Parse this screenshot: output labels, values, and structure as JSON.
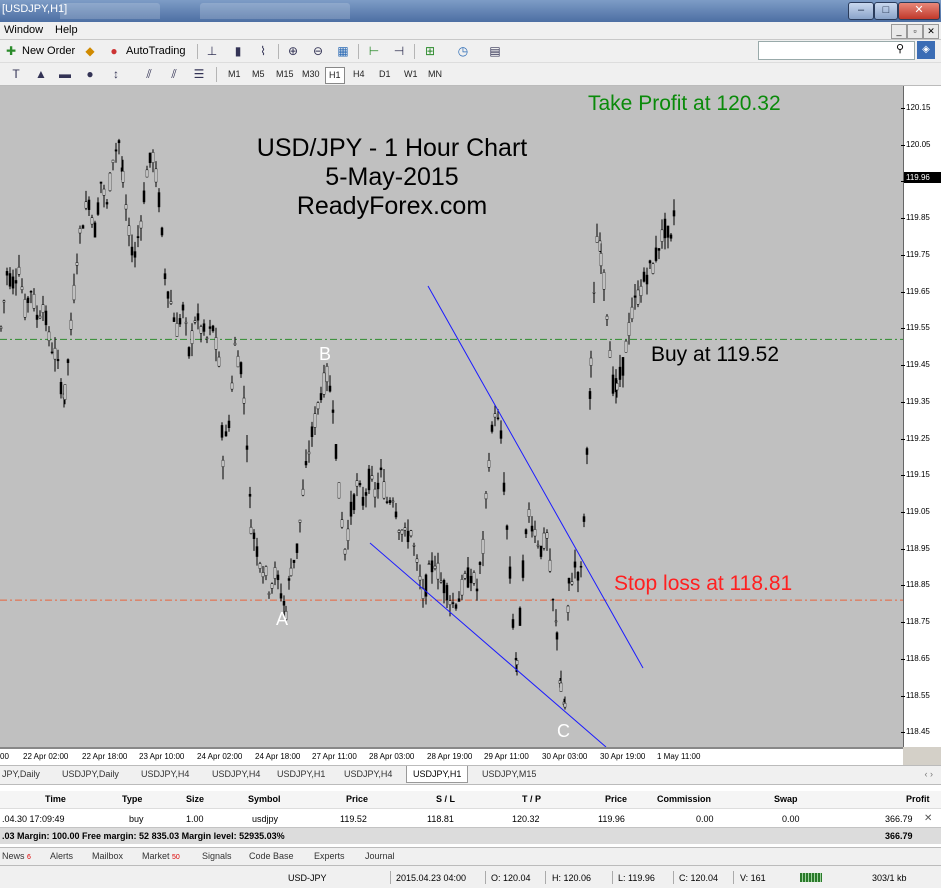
{
  "window": {
    "title": "[USDJPY,H1]",
    "controls": {
      "minimize": "–",
      "maximize": "□",
      "close": "✕"
    }
  },
  "menu": {
    "items": [
      "Window",
      "Help"
    ],
    "mdi_controls": [
      "_",
      "▫",
      "✕"
    ]
  },
  "toolbar1": {
    "new_order": "New Order",
    "autotrading": "AutoTrading",
    "icons": [
      "new-order-icon",
      "experts-icon",
      "autotrading-icon",
      "bar-chart-icon",
      "candlestick-icon",
      "line-chart-icon",
      "zoom-in-icon",
      "zoom-out-icon",
      "tile-windows-icon",
      "auto-scroll-icon",
      "chart-shift-icon",
      "indicators-icon",
      "periods-icon",
      "templates-icon"
    ]
  },
  "toolbar2": {
    "tools": [
      "T",
      "▲",
      "▬",
      "●",
      "↕",
      "⫽",
      "⫽",
      "☰"
    ],
    "timeframes": [
      "M1",
      "M5",
      "M15",
      "M30",
      "H1",
      "H4",
      "D1",
      "W1",
      "MN"
    ],
    "active_timeframe": "H1"
  },
  "search": {
    "placeholder": "",
    "icon": "search-icon"
  },
  "chart": {
    "title_lines": [
      "USD/JPY - 1 Hour Chart",
      "5-May-2015",
      "ReadyForex.com"
    ],
    "annotations": {
      "take_profit": "Take Profit at 120.32",
      "buy": "Buy at 119.52",
      "stop_loss": "Stop loss at 118.81"
    },
    "points": [
      "A",
      "B",
      "C"
    ],
    "current_price": "119.96",
    "price_ticks": [
      "120.15",
      "120.05",
      "119.95",
      "119.85",
      "119.75",
      "119.65",
      "119.55",
      "119.45",
      "119.35",
      "119.25",
      "119.15",
      "119.05",
      "118.95",
      "118.85",
      "118.75",
      "118.65",
      "118.55",
      "118.45"
    ],
    "time_ticks": [
      "00",
      "22 Apr 02:00",
      "22 Apr 18:00",
      "23 Apr 10:00",
      "24 Apr 02:00",
      "24 Apr 18:00",
      "27 Apr 11:00",
      "28 Apr 03:00",
      "28 Apr 19:00",
      "29 Apr 11:00",
      "30 Apr 03:00",
      "30 Apr 19:00",
      "1 May 11:00"
    ],
    "colors": {
      "background": "#c0c0c0",
      "take_profit": "#0a8a0a",
      "stop_loss": "#ff2020",
      "trendline": "#1a1aff",
      "buy_line": "#2e8b2e",
      "sl_line": "#e8643c"
    }
  },
  "chart_data": {
    "type": "candlestick",
    "title": "USD/JPY - 1 Hour Chart",
    "subtitle": "5-May-2015",
    "ylim": [
      118.41,
      120.21
    ],
    "y_ticks": [
      120.15,
      120.05,
      119.95,
      119.85,
      119.75,
      119.65,
      119.55,
      119.45,
      119.35,
      119.25,
      119.15,
      119.05,
      118.95,
      118.85,
      118.75,
      118.65,
      118.55,
      118.45
    ],
    "levels": {
      "take_profit": 120.32,
      "buy": 119.52,
      "stop_loss": 118.81
    },
    "current_price": 119.96,
    "path": [
      [
        0,
        119.55
      ],
      [
        6,
        119.7
      ],
      [
        12,
        119.68
      ],
      [
        18,
        119.72
      ],
      [
        24,
        119.6
      ],
      [
        30,
        119.66
      ],
      [
        36,
        119.58
      ],
      [
        42,
        119.62
      ],
      [
        48,
        119.52
      ],
      [
        54,
        119.48
      ],
      [
        60,
        119.4
      ],
      [
        64,
        119.37
      ],
      [
        70,
        119.55
      ],
      [
        76,
        119.75
      ],
      [
        82,
        119.85
      ],
      [
        88,
        119.9
      ],
      [
        94,
        119.82
      ],
      [
        100,
        119.95
      ],
      [
        106,
        119.88
      ],
      [
        112,
        120.02
      ],
      [
        118,
        120.06
      ],
      [
        122,
        119.95
      ],
      [
        128,
        119.8
      ],
      [
        134,
        119.75
      ],
      [
        140,
        119.85
      ],
      [
        146,
        119.98
      ],
      [
        152,
        120.02
      ],
      [
        158,
        119.9
      ],
      [
        164,
        119.7
      ],
      [
        170,
        119.62
      ],
      [
        176,
        119.55
      ],
      [
        182,
        119.6
      ],
      [
        188,
        119.48
      ],
      [
        194,
        119.58
      ],
      [
        200,
        119.55
      ],
      [
        206,
        119.52
      ],
      [
        212,
        119.55
      ],
      [
        218,
        119.45
      ],
      [
        222,
        119.2
      ],
      [
        228,
        119.3
      ],
      [
        234,
        119.5
      ],
      [
        240,
        119.45
      ],
      [
        246,
        119.25
      ],
      [
        250,
        119.02
      ],
      [
        256,
        118.95
      ],
      [
        262,
        118.9
      ],
      [
        268,
        118.85
      ],
      [
        274,
        118.88
      ],
      [
        280,
        118.83
      ],
      [
        285,
        118.78
      ],
      [
        290,
        118.9
      ],
      [
        296,
        118.95
      ],
      [
        302,
        119.1
      ],
      [
        308,
        119.22
      ],
      [
        314,
        119.3
      ],
      [
        320,
        119.38
      ],
      [
        326,
        119.42
      ],
      [
        332,
        119.35
      ],
      [
        338,
        119.1
      ],
      [
        344,
        118.95
      ],
      [
        350,
        119.05
      ],
      [
        356,
        119.12
      ],
      [
        362,
        119.08
      ],
      [
        368,
        119.14
      ],
      [
        374,
        119.1
      ],
      [
        380,
        119.15
      ],
      [
        386,
        119.08
      ],
      [
        392,
        119.1
      ],
      [
        398,
        119.02
      ],
      [
        404,
        118.98
      ],
      [
        410,
        119.0
      ],
      [
        416,
        118.9
      ],
      [
        422,
        118.82
      ],
      [
        428,
        118.88
      ],
      [
        434,
        118.92
      ],
      [
        440,
        118.86
      ],
      [
        446,
        118.84
      ],
      [
        452,
        118.8
      ],
      [
        458,
        118.82
      ],
      [
        464,
        118.86
      ],
      [
        470,
        118.88
      ],
      [
        476,
        118.84
      ],
      [
        482,
        118.95
      ],
      [
        488,
        119.2
      ],
      [
        494,
        119.33
      ],
      [
        500,
        119.25
      ],
      [
        506,
        119.0
      ],
      [
        512,
        118.75
      ],
      [
        516,
        118.62
      ],
      [
        522,
        118.9
      ],
      [
        528,
        119.05
      ],
      [
        534,
        119.0
      ],
      [
        540,
        118.95
      ],
      [
        546,
        118.98
      ],
      [
        552,
        118.8
      ],
      [
        556,
        118.72
      ],
      [
        560,
        118.56
      ],
      [
        564,
        118.52
      ],
      [
        568,
        118.85
      ],
      [
        574,
        118.9
      ],
      [
        580,
        118.88
      ],
      [
        586,
        119.2
      ],
      [
        590,
        119.45
      ],
      [
        596,
        119.8
      ],
      [
        600,
        119.75
      ],
      [
        606,
        119.6
      ],
      [
        612,
        119.4
      ],
      [
        616,
        119.38
      ],
      [
        622,
        119.45
      ],
      [
        628,
        119.55
      ],
      [
        634,
        119.62
      ],
      [
        640,
        119.66
      ],
      [
        646,
        119.7
      ],
      [
        652,
        119.72
      ],
      [
        658,
        119.78
      ],
      [
        664,
        119.82
      ],
      [
        670,
        119.78
      ],
      [
        676,
        119.96
      ]
    ],
    "x_labels": [
      "00",
      "22 Apr 02:00",
      "22 Apr 18:00",
      "23 Apr 10:00",
      "24 Apr 02:00",
      "24 Apr 18:00",
      "27 Apr 11:00",
      "28 Apr 03:00",
      "28 Apr 19:00",
      "29 Apr 11:00",
      "30 Apr 03:00",
      "30 Apr 19:00",
      "1 May 11:00"
    ]
  },
  "chart_tabs": {
    "items": [
      "JPY,Daily",
      "USDJPY,Daily",
      "USDJPY,H4",
      "USDJPY,H4",
      "USDJPY,H1",
      "USDJPY,H4",
      "USDJPY,H1",
      "USDJPY,M15"
    ],
    "active_index": 6,
    "scroll": "‹ ›"
  },
  "terminal": {
    "headers": [
      "Time",
      "Type",
      "Size",
      "Symbol",
      "Price",
      "S / L",
      "T / P",
      "Price",
      "Commission",
      "Swap",
      "Profit"
    ],
    "order": {
      "time": ".04.30 17:09:49",
      "type": "buy",
      "size": "1.00",
      "symbol": "usdjpy",
      "price": "119.52",
      "sl": "118.81",
      "tp": "120.32",
      "current_price": "119.96",
      "commission": "0.00",
      "swap": "0.00",
      "profit": "366.79"
    },
    "balance_text": ".03  Margin: 100.00  Free margin: 52 835.03  Margin level: 52935.03%",
    "balance_profit": "366.79"
  },
  "bottom_tabs": {
    "items": [
      {
        "label": "News",
        "badge": "6"
      },
      {
        "label": "Alerts",
        "badge": ""
      },
      {
        "label": "Mailbox",
        "badge": ""
      },
      {
        "label": "Market",
        "badge": "50"
      },
      {
        "label": "Signals",
        "badge": ""
      },
      {
        "label": "Code Base",
        "badge": ""
      },
      {
        "label": "Experts",
        "badge": ""
      },
      {
        "label": "Journal",
        "badge": ""
      }
    ]
  },
  "status": {
    "symbol": "USD-JPY",
    "datetime": "2015.04.23 04:00",
    "open": "O: 120.04",
    "high": "H: 120.06",
    "low": "L: 119.96",
    "close": "C: 120.04",
    "volume": "V: 161",
    "traffic": "303/1 kb"
  }
}
